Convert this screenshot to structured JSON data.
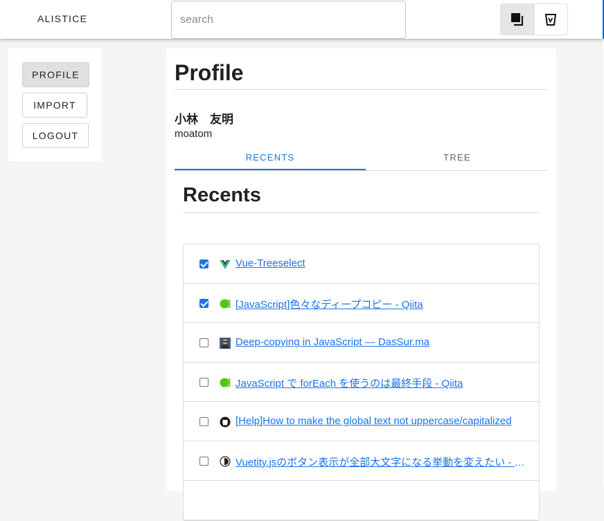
{
  "header": {
    "brand": "ALISTICE",
    "search": {
      "placeholder": "search",
      "value": ""
    },
    "view_toggle": {
      "active": "card-view",
      "icons": [
        "layers-icon",
        "cup-icon"
      ]
    }
  },
  "nav": {
    "items": [
      {
        "label": "PROFILE",
        "active": true
      },
      {
        "label": "IMPORT",
        "active": false
      },
      {
        "label": "LOGOUT",
        "active": false
      }
    ]
  },
  "profile": {
    "title": "Profile",
    "full_name": "小林　友明",
    "username": "moatom"
  },
  "tabs": [
    {
      "label": "RECENTS",
      "active": true
    },
    {
      "label": "TREE",
      "active": false
    }
  ],
  "recents": {
    "title": "Recents",
    "items": [
      {
        "checked": true,
        "icon": "vue-icon",
        "title": "Vue-Treeselect"
      },
      {
        "checked": true,
        "icon": "qiita-icon",
        "title": "[JavaScript]色々なディープコピー - Qiita"
      },
      {
        "checked": false,
        "icon": "avatar-icon",
        "title": "Deep-copying in JavaScript — DasSur.ma"
      },
      {
        "checked": false,
        "icon": "qiita-icon",
        "title": "JavaScript で forEach を使うのは最終手段 - Qiita"
      },
      {
        "checked": false,
        "icon": "github-icon",
        "title": "[Help]How to make the global text not uppercase/capitalized"
      },
      {
        "checked": false,
        "icon": "vuetify-icon",
        "title": "Vuetity.jsのボタン表示が全部大文字になる挙動を変えたい - Qiita"
      }
    ]
  },
  "colors": {
    "accent": "#1976d2",
    "link": "#1a73e8",
    "qiita_green": "#55c500",
    "vue_green": "#41b883",
    "header_edge": "#1565c0"
  }
}
